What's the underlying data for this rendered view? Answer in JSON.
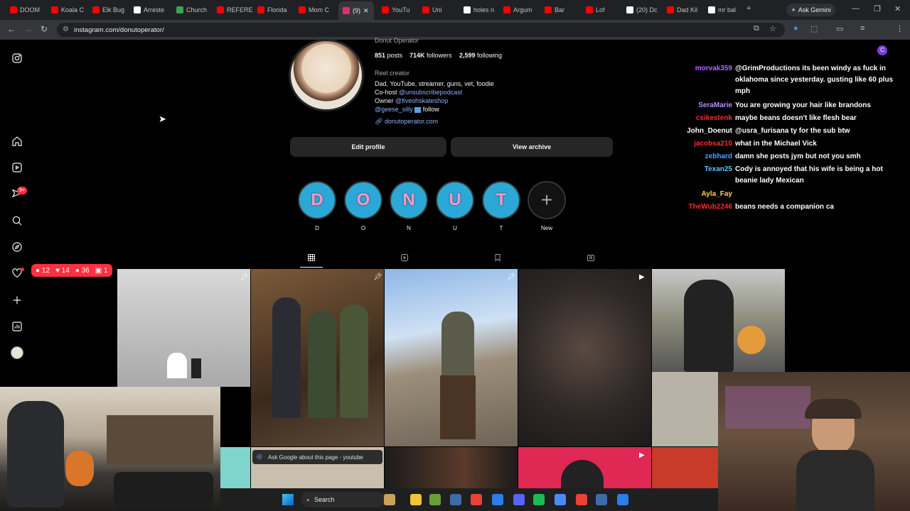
{
  "browser": {
    "tabs": [
      {
        "label": "DOOM",
        "color": "#ff0000"
      },
      {
        "label": "Koala C",
        "color": "#ff0000"
      },
      {
        "label": "Elk Bug",
        "color": "#ff0000"
      },
      {
        "label": "Arreste",
        "color": "#ffffff"
      },
      {
        "label": "Church",
        "color": "#34a853"
      },
      {
        "label": "REFERE",
        "color": "#ff0000"
      },
      {
        "label": "Florida",
        "color": "#ff0000"
      },
      {
        "label": "Mom C",
        "color": "#ff0000"
      },
      {
        "label": "(9)",
        "color": "#e1306c"
      },
      {
        "label": "YouTu",
        "color": "#ff0000"
      },
      {
        "label": "Uni",
        "color": "#ff0000"
      },
      {
        "label": "holes n",
        "color": "#ffffff"
      },
      {
        "label": "Argum",
        "color": "#ff0000"
      },
      {
        "label": "Bar",
        "color": "#ff0000"
      },
      {
        "label": "Lof",
        "color": "#ff0000"
      },
      {
        "label": "(20) Dc",
        "color": "#ffffff"
      },
      {
        "label": "Dad Kil",
        "color": "#ff0000"
      },
      {
        "label": "mr bal",
        "color": "#ffffff"
      }
    ],
    "ask_gemini": "Ask Gemini",
    "url": "instagram.com/donutoperator/"
  },
  "notification_badge": {
    "comments": "12",
    "likes": "14",
    "follows": "36",
    "requests": "1",
    "new_count": "9+"
  },
  "profile": {
    "name": "Donut Operator",
    "posts": "851",
    "posts_label": "posts",
    "followers": "714K",
    "followers_label": "followers",
    "following": "2,599",
    "following_label": "following",
    "category": "Reel creator",
    "bio_line1": "Dad, YouTube, streamer, guns, vet, foodie",
    "bio_cohost_prefix": "Co-host ",
    "bio_cohost_link": "@unsubscribepodcast",
    "bio_owner_prefix": "Owner ",
    "bio_owner_link": "@fiveohskateshop",
    "bio_geese_link": "@geese_silly",
    "bio_geese_suffix": " follow",
    "website": "donutoperator.com",
    "edit_profile": "Edit profile",
    "view_archive": "View archive"
  },
  "highlights": [
    {
      "letter": "D",
      "label": "D"
    },
    {
      "letter": "O",
      "label": "O"
    },
    {
      "letter": "N",
      "label": "N"
    },
    {
      "letter": "U",
      "label": "U"
    },
    {
      "letter": "T",
      "label": "T"
    },
    {
      "letter": "+",
      "label": "New"
    }
  ],
  "chat": [
    {
      "user": "morvak359",
      "color": "#b06bff",
      "msg": "@GrimProductions its been windy as fuck in oklahoma since yesterday. gusting like 60 plus mph"
    },
    {
      "user": "SeraMarie",
      "color": "#b98cff",
      "msg": "You are growing your hair like brandons"
    },
    {
      "user": "csikestenk",
      "color": "#ff2b2b",
      "msg": "maybe beans doesn't like flesh bear"
    },
    {
      "user": "John_Doenut",
      "color": "#ffffff",
      "msg": "@usra_furisana ty for the sub btw"
    },
    {
      "user": "jacobsa210",
      "color": "#ff2b2b",
      "msg": "what in the Michael Vick"
    },
    {
      "user": "zebhard",
      "color": "#4da3ff",
      "msg": "damn she posts jym but not you smh"
    },
    {
      "user": "Texan25",
      "color": "#5cc6ff",
      "msg": "Cody is annoyed that his wife is being a hot beanie lady Mexican"
    },
    {
      "user": "Ayla_Fay",
      "color": "#ffd24a",
      "msg": ""
    },
    {
      "user": "TheWub2246",
      "color": "#ff2b2b",
      "msg": "beans needs a companion ca"
    }
  ],
  "ask_google": "Ask Google about this page - youtube",
  "taskbar": {
    "search": "Search"
  }
}
